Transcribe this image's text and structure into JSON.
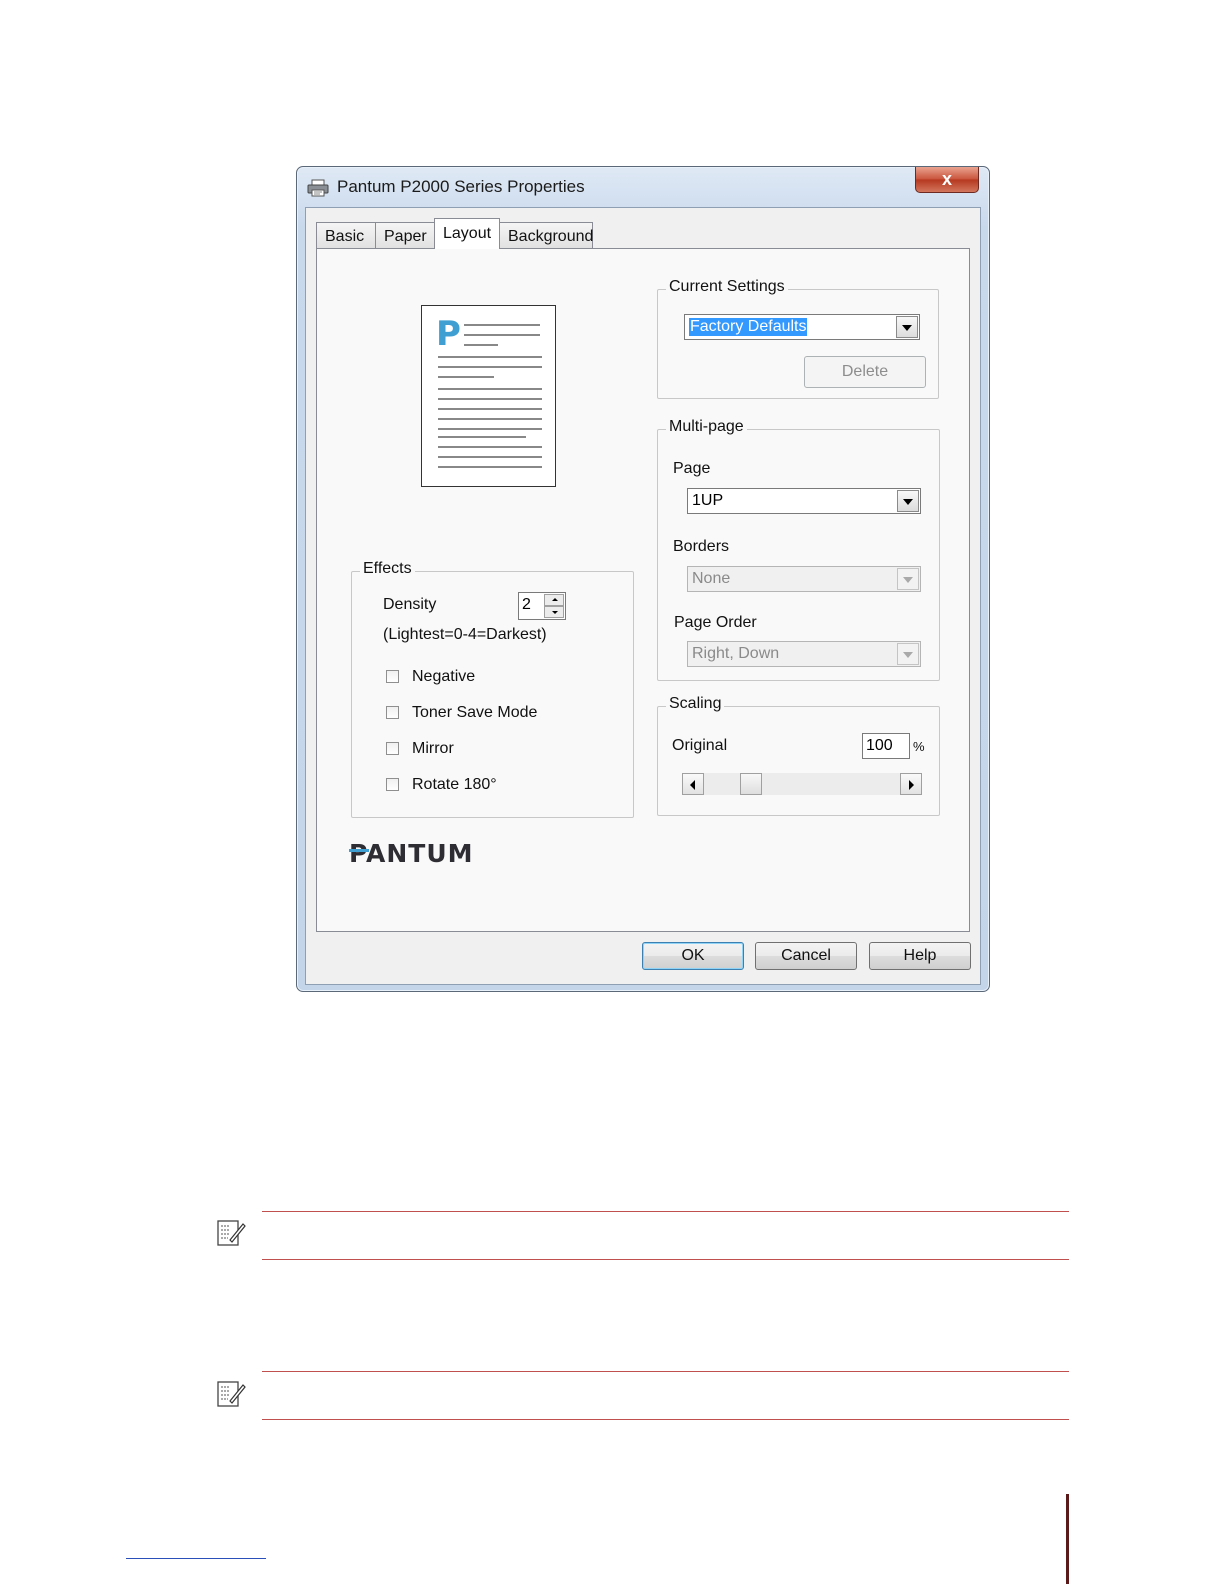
{
  "window": {
    "title": "Pantum P2000 Series Properties",
    "close_glyph": "x",
    "tabs": [
      {
        "label": "Basic",
        "active": false
      },
      {
        "label": "Paper",
        "active": false
      },
      {
        "label": "Layout",
        "active": true
      },
      {
        "label": "Background",
        "active": false
      }
    ]
  },
  "preview": {
    "letter": "P"
  },
  "current_settings": {
    "label": "Current Settings",
    "value": "Factory Defaults",
    "delete_button": "Delete"
  },
  "multipage": {
    "label": "Multi-page",
    "page_label": "Page",
    "page_value": "1UP",
    "borders_label": "Borders",
    "borders_value": "None",
    "order_label": "Page Order",
    "order_value": "Right, Down"
  },
  "effects": {
    "label": "Effects",
    "density_label": "Density",
    "density_value": "2",
    "density_hint": "(Lightest=0-4=Darkest)",
    "checkboxes": [
      {
        "label": "Negative",
        "checked": false
      },
      {
        "label": "Toner Save Mode",
        "checked": false
      },
      {
        "label": "Mirror",
        "checked": false
      },
      {
        "label": "Rotate 180°",
        "checked": false
      }
    ]
  },
  "scaling": {
    "label": "Scaling",
    "original_label": "Original",
    "value": "100",
    "unit": "%"
  },
  "brand": {
    "logo_text": "PANTUM"
  },
  "buttons": {
    "ok": "OK",
    "cancel": "Cancel",
    "help": "Help"
  },
  "icons": {
    "title": "printer-icon",
    "note": "note-icon"
  },
  "colors": {
    "accent": "#3f9fd2",
    "note_rule": "#c0504d",
    "selection": "#3399ff"
  }
}
